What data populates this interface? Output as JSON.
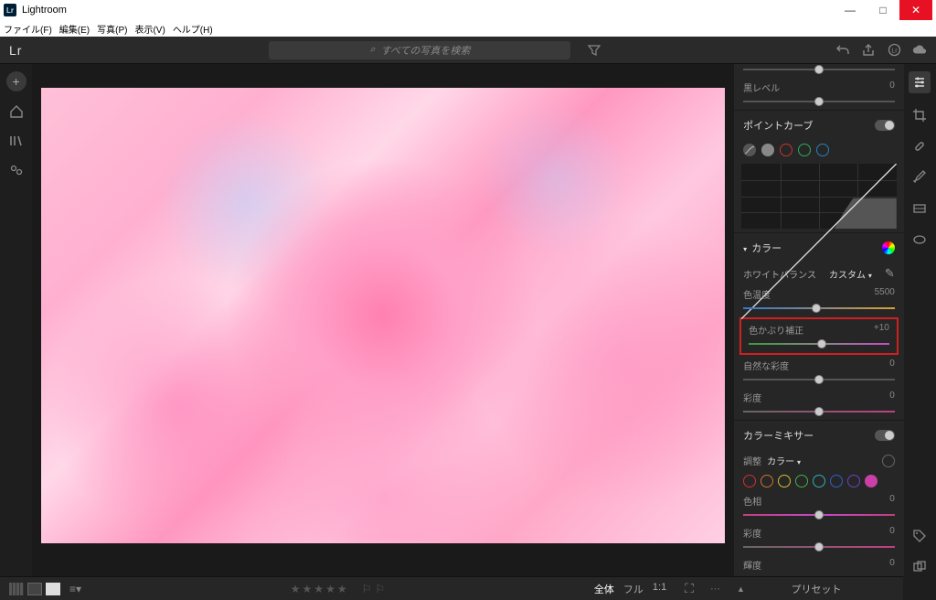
{
  "window": {
    "title": "Lightroom"
  },
  "menu": {
    "file": "ファイル(F)",
    "edit": "編集(E)",
    "photo": "写真(P)",
    "view": "表示(V)",
    "help": "ヘルプ(H)"
  },
  "topbar": {
    "logo": "Lr",
    "search_placeholder": "すべての写真を検索"
  },
  "sliders": {
    "black": {
      "label": "黒レベル",
      "value": "0",
      "pos": 50
    },
    "temp": {
      "label": "色温度",
      "value": "5500",
      "pos": 48
    },
    "tint": {
      "label": "色かぶり補正",
      "value": "+10",
      "pos": 52
    },
    "vibrance": {
      "label": "自然な彩度",
      "value": "0",
      "pos": 50
    },
    "saturation": {
      "label": "彩度",
      "value": "0",
      "pos": 50
    },
    "hue": {
      "label": "色相",
      "value": "0",
      "pos": 50
    },
    "sat2": {
      "label": "彩度",
      "value": "0",
      "pos": 50
    }
  },
  "sections": {
    "pointcurve": "ポイントカーブ",
    "color": "カラー",
    "colormixer": "カラーミキサー"
  },
  "wb": {
    "label": "ホワイトバランス",
    "value": "カスタム"
  },
  "mixer": {
    "adjust_label": "調整",
    "adjust_value": "カラー"
  },
  "bottom": {
    "zoom_full": "全体",
    "zoom_fill": "フル",
    "zoom_11": "1:1"
  },
  "presets": {
    "label": "プリセット"
  }
}
